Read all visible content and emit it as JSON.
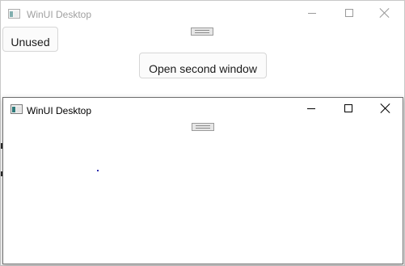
{
  "back_window": {
    "title": "WinUI Desktop",
    "unused_button_label": "Unused",
    "open_button_label": "Open second window"
  },
  "front_window": {
    "title": "WinUI Desktop"
  },
  "icons": {
    "app": "app-window-icon",
    "minimize": "minimize-icon",
    "maximize": "maximize-icon",
    "close": "close-icon",
    "drag_handle": "drag-handle-icon"
  },
  "colors": {
    "inactive_caption_text": "#a0a0a0",
    "active_caption_text": "#000000",
    "window_background": "#ffffff",
    "button_background": "#fbfbfb",
    "button_border": "#d6d6d6"
  }
}
